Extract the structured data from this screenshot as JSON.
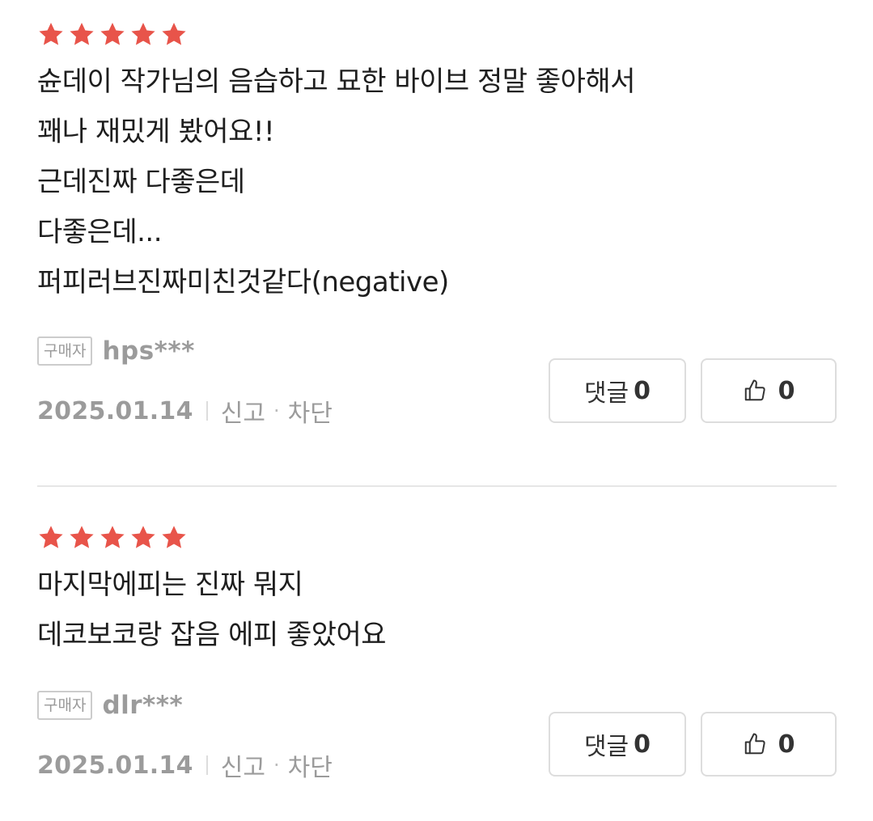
{
  "colors": {
    "star": "#e8544a",
    "muted": "#9b9b9b",
    "divider": "#e6e6e6"
  },
  "reviews": [
    {
      "rating": 5,
      "lines": [
        "슌데이 작가님의 음습하고 묘한 바이브 정말 좋아해서",
        "꽤나 재밌게 봤어요!!",
        "근데진짜 다좋은데",
        "다좋은데...",
        "퍼피러브진짜미친것같다(negative)"
      ],
      "badge": "구매자",
      "username": "hps***",
      "date": "2025.01.14",
      "report": "신고",
      "block": "차단",
      "comment_label": "댓글",
      "comment_count": "0",
      "like_count": "0",
      "like_icon": "thumbs-up-icon"
    },
    {
      "rating": 5,
      "lines": [
        "마지막에피는 진짜 뭐지",
        "데코보코랑 잡음 에피 좋았어요"
      ],
      "badge": "구매자",
      "username": "dlr***",
      "date": "2025.01.14",
      "report": "신고",
      "block": "차단",
      "comment_label": "댓글",
      "comment_count": "0",
      "like_count": "0",
      "like_icon": "thumbs-up-icon"
    }
  ]
}
